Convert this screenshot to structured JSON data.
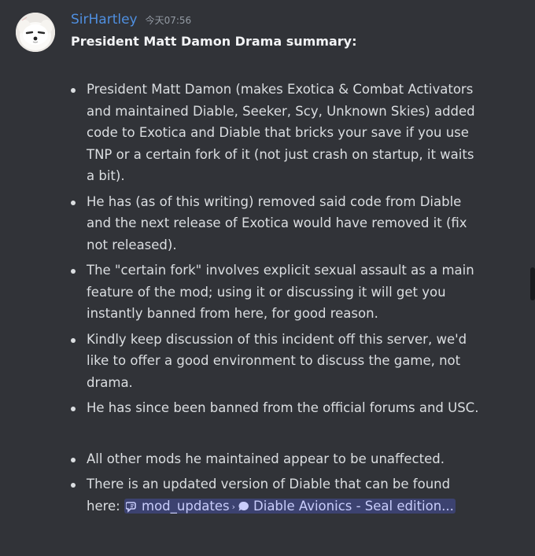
{
  "message": {
    "author": "SirHartley",
    "timestamp": "今天07:56",
    "title": "President Matt Damon Drama summary:",
    "bullets": [
      "President Matt Damon (makes Exotica & Combat Activators and maintained Diable, Seeker, Scy, Unknown Skies) added code to Exotica and Diable that bricks your save if you use TNP or a certain fork of it (not just crash on startup, it waits a bit).",
      "He has (as of this writing) removed said code from Diable and the next release of Exotica would have removed it (fix not released).",
      "The \"certain fork\" involves explicit sexual assault as a main feature of the mod; using it or discussing it will get you instantly banned from here, for good reason.",
      "Kindly keep discussion of this incident off this server, we'd like to offer a good environment to discuss the game, not drama.",
      "He has since been banned from the official forums and USC.",
      "All other mods he maintained appear to be unaffected."
    ],
    "last_bullet": {
      "prefix": "There is an updated version of Diable that can be found here: ",
      "channel_link": {
        "channel": "mod_updates",
        "separator_icon": "chevron-right-icon",
        "thread": "Diable Avionics - Seal edition...",
        "channel_icon": "forum-icon",
        "thread_icon": "thread-icon"
      }
    }
  },
  "colors": {
    "background": "#313338",
    "username": "#4f8fe0",
    "text": "#dbdee1",
    "mention_bg": "#3c4270",
    "mention_text": "#c9cdfb"
  }
}
